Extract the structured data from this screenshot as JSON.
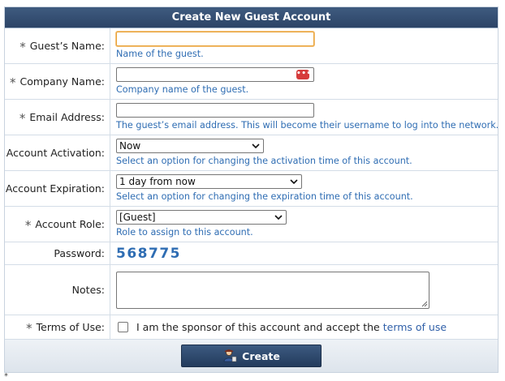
{
  "form": {
    "title": "Create New Guest Account",
    "required_marker": "*",
    "guest_name": {
      "label": "Guest’s Name:",
      "value": "",
      "hint": "Name of the guest."
    },
    "company_name": {
      "label": "Company Name:",
      "value": "",
      "hint": "Company name of the guest.",
      "icon": "more-dots-icon"
    },
    "email": {
      "label": "Email Address:",
      "value": "",
      "hint": "The guest’s email address. This will become their username to log into the network."
    },
    "activation": {
      "label": "Account Activation:",
      "selected": "Now",
      "hint": "Select an option for changing the activation time of this account."
    },
    "expiration": {
      "label": "Account Expiration:",
      "selected": "1 day from now",
      "hint": "Select an option for changing the expiration time of this account."
    },
    "role": {
      "label": "Account Role:",
      "selected": "[Guest]",
      "hint": "Role to assign to this account."
    },
    "password": {
      "label": "Password:",
      "value": "568775"
    },
    "notes": {
      "label": "Notes:",
      "value": ""
    },
    "terms": {
      "label": "Terms of Use:",
      "text": "I am the sponsor of this account and accept the",
      "link": "terms of use",
      "checked": false
    },
    "create_button": "Create",
    "footnote": "*"
  },
  "colors": {
    "header_bg": "#2c4467",
    "hint_text": "#2f6db3",
    "focus_border": "#e8a33a",
    "link": "#2f5fa8"
  }
}
